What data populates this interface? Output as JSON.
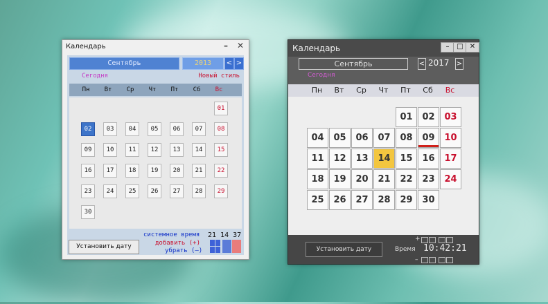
{
  "window1": {
    "title": "Календарь",
    "min_glyph": "–",
    "close_glyph": "✕",
    "month": "Сентябрь",
    "year": "2013",
    "prev_glyph": "<",
    "next_glyph": ">",
    "today_label": "Сегодня",
    "new_style_label": "Новый стиль",
    "weekdays": [
      "Пн",
      "Вт",
      "Ср",
      "Чт",
      "Пт",
      "Сб",
      "Вс"
    ],
    "weeks": [
      [
        "",
        "",
        "",
        "",
        "",
        "",
        "01"
      ],
      [
        "02",
        "03",
        "04",
        "05",
        "06",
        "07",
        "08"
      ],
      [
        "09",
        "10",
        "11",
        "12",
        "13",
        "14",
        "15"
      ],
      [
        "16",
        "17",
        "18",
        "19",
        "20",
        "21",
        "22"
      ],
      [
        "23",
        "24",
        "25",
        "26",
        "27",
        "28",
        "29"
      ],
      [
        "30",
        "",
        "",
        "",
        "",
        "",
        ""
      ]
    ],
    "selected_day": "02",
    "system_time_label": "системное время",
    "system_time": "21 14 37",
    "set_date_button": "Установить дату",
    "add_label": "добавить (+)",
    "remove_label": "убрать (–)",
    "colors": {
      "accent": "#3d74c9",
      "sunday": "#c8102e"
    }
  },
  "window2": {
    "title": "Календарь",
    "min_glyph": "–",
    "max_glyph": "□",
    "close_glyph": "✕",
    "month": "Сентябрь",
    "year": "2017",
    "prev_glyph": "<",
    "next_glyph": ">",
    "today_label": "Сегодня",
    "weekdays": [
      "Пн",
      "Вт",
      "Ср",
      "Чт",
      "Пт",
      "Сб",
      "Вс"
    ],
    "weeks": [
      [
        "",
        "",
        "",
        "",
        "01",
        "02",
        "03"
      ],
      [
        "04",
        "05",
        "06",
        "07",
        "08",
        "09",
        "10"
      ],
      [
        "11",
        "12",
        "13",
        "14",
        "15",
        "16",
        "17"
      ],
      [
        "18",
        "19",
        "20",
        "21",
        "22",
        "23",
        "24"
      ],
      [
        "25",
        "26",
        "27",
        "28",
        "29",
        "30",
        ""
      ]
    ],
    "selected_day": "14",
    "marked_day": "09",
    "set_date_button": "Установить дату",
    "time_label": "Время",
    "clock": "10:42:21",
    "plus": "+",
    "minus": "–",
    "colors": {
      "selected": "#f3c63f",
      "sunday": "#c8102e",
      "marker": "#d0201a"
    }
  }
}
